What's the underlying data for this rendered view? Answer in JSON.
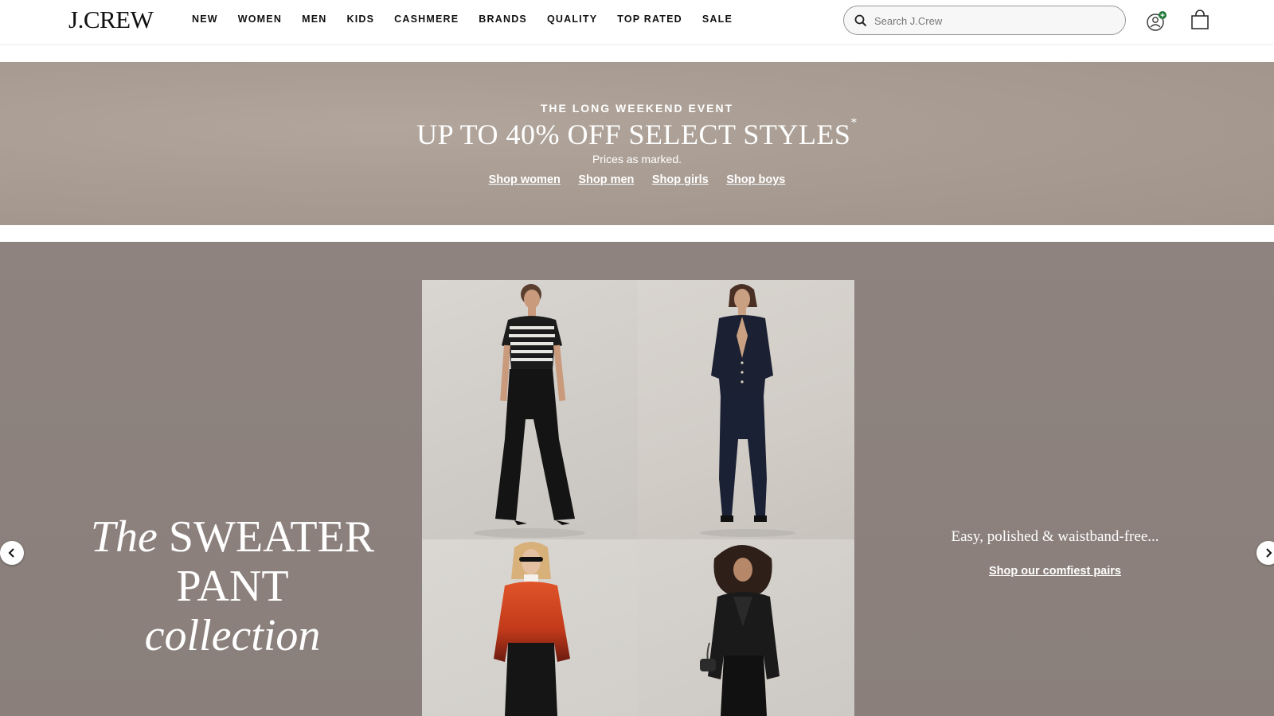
{
  "header": {
    "logo": "J.CREW",
    "nav": [
      "NEW",
      "WOMEN",
      "MEN",
      "KIDS",
      "CASHMERE",
      "BRANDS",
      "QUALITY",
      "TOP RATED",
      "SALE"
    ],
    "search_placeholder": "Search J.Crew"
  },
  "promo": {
    "eyebrow": "THE LONG WEEKEND EVENT",
    "headline": "UP TO 40% OFF SELECT STYLES",
    "headline_mark": "*",
    "subtext": "Prices as marked.",
    "links": [
      "Shop women",
      "Shop men",
      "Shop girls",
      "Shop boys"
    ]
  },
  "hero": {
    "title_line1_italic": "The",
    "title_line1_upper": " SWEATER",
    "title_line2_upper": "PANT",
    "title_line2_italic": " collection",
    "tagline": "Easy, polished & waistband-free...",
    "cta": "Shop our comfiest pairs"
  },
  "colors": {
    "promo_bg": "#a99d93",
    "hero_bg": "#8c817d",
    "account_badge": "#1f7a3a"
  },
  "icons": {
    "search": "search-icon",
    "account": "account-icon",
    "bag": "shopping-bag-icon",
    "prev": "chevron-left-icon",
    "next": "chevron-right-icon"
  }
}
